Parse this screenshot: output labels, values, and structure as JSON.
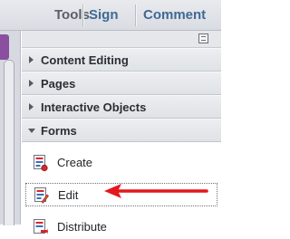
{
  "toolbar": {
    "tabs": [
      "Tools",
      "Sign",
      "Comment"
    ]
  },
  "panel": {
    "sections": [
      {
        "label": "Content Editing",
        "expanded": false
      },
      {
        "label": "Pages",
        "expanded": false
      },
      {
        "label": "Interactive Objects",
        "expanded": false
      },
      {
        "label": "Forms",
        "expanded": true
      }
    ],
    "forms_items": [
      "Create",
      "Edit",
      "Distribute"
    ]
  },
  "colors": {
    "tab_active": "#5b5f66",
    "tab_link": "#3f6a95",
    "annotation_arrow": "#e3171c",
    "left_accent": "#8a4f9e"
  },
  "icons": {
    "panel_menu": "panel-options-icon",
    "form_item": "form-document-icon"
  }
}
